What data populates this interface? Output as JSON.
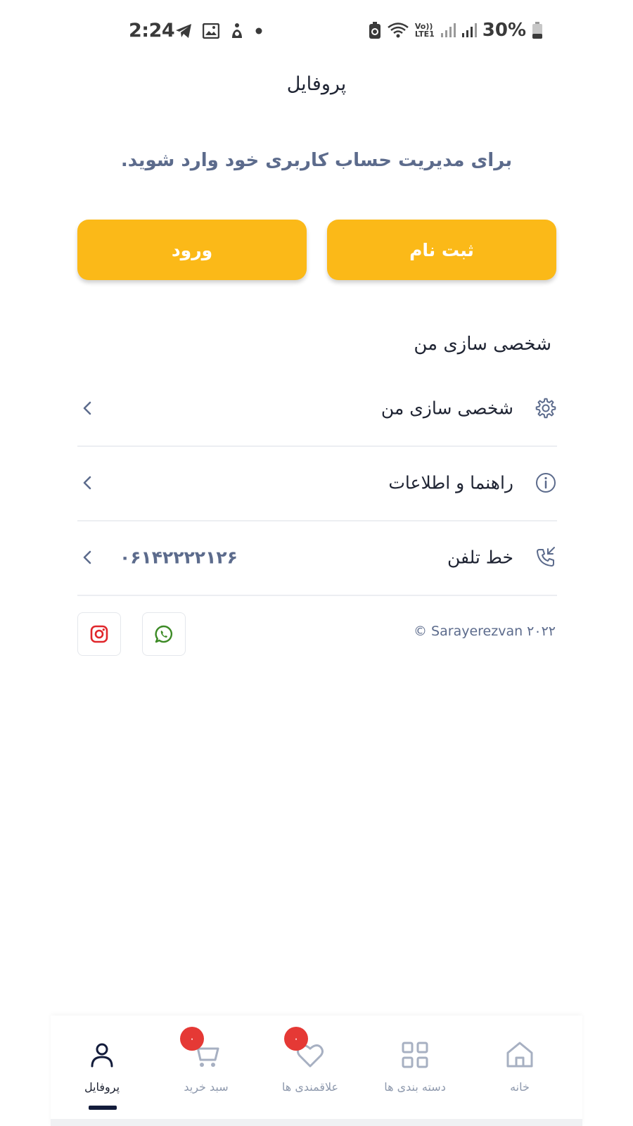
{
  "status_bar": {
    "time": "2:24",
    "battery": "30%",
    "icons_left": [
      "telegram-icon",
      "image-icon",
      "accessibility-icon",
      "dot-icon"
    ],
    "icons_right": [
      "battery-saver-icon",
      "wifi-icon",
      "volte-icon",
      "signal-icon",
      "signal-icon",
      "battery-icon"
    ],
    "volte_label": "Vo))",
    "lte_label": "LTE1"
  },
  "header": {
    "title": "پروفایل"
  },
  "prompt": "برای مدیریت حساب کاربری خود وارد شوید.",
  "buttons": {
    "register": "ثبت نام",
    "login": "ورود"
  },
  "section_title": "شخصی سازی من",
  "menu": {
    "personalize": {
      "label": "شخصی سازی من",
      "icon": "gear-icon"
    },
    "help": {
      "label": "راهنما و اطلاعات",
      "icon": "info-icon"
    },
    "phone": {
      "label": "خط تلفن",
      "value": "۰۶۱۴۲۲۲۲۱۲۶",
      "icon": "phone-icon"
    }
  },
  "footer": {
    "copyright": "© Sarayerezvan ۲۰۲۲",
    "social": [
      "instagram-icon",
      "whatsapp-icon"
    ]
  },
  "bottom_nav": {
    "home": "خانه",
    "categories": "دسته بندی ها",
    "favorites": "علاقمندی ها",
    "favorites_badge": "۰",
    "cart": "سبد خرید",
    "cart_badge": "۰",
    "profile": "پروفایل"
  },
  "colors": {
    "accent": "#fbb918",
    "muted_text": "#5c6b8c",
    "badge": "#e53935",
    "active_nav": "#131c3b"
  }
}
